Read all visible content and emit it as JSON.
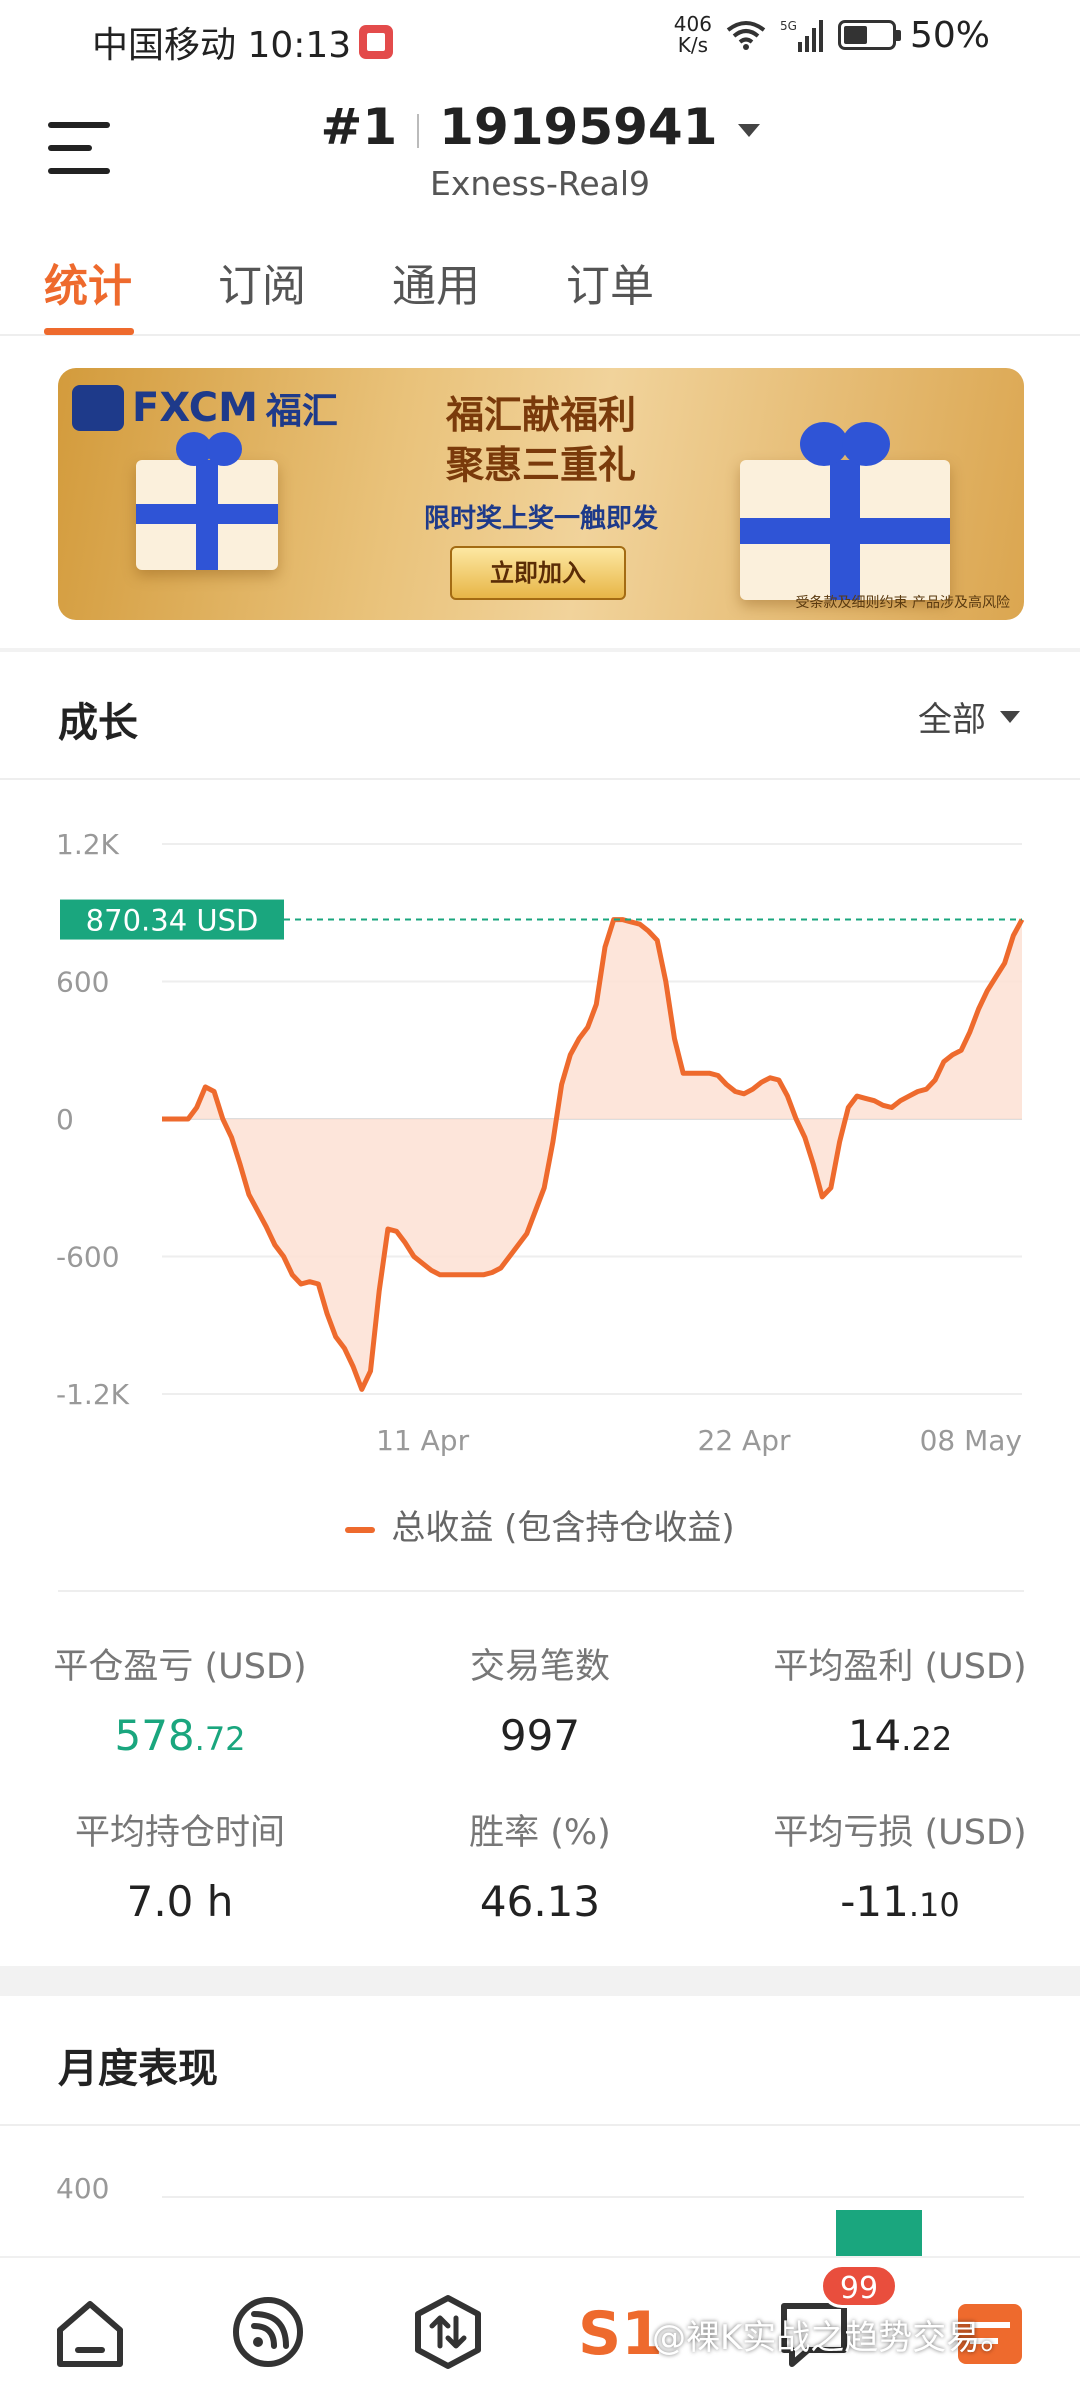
{
  "status_bar": {
    "carrier_time": "中国移动 10:13",
    "net_speed_value": "406",
    "net_speed_unit": "K/s",
    "signal": "5G",
    "battery": "50%",
    "battery_level": 0.5
  },
  "header": {
    "rank": "#1",
    "account_number": "19195941",
    "server": "Exness-Real9"
  },
  "tabs": [
    {
      "label": "统计",
      "active": true
    },
    {
      "label": "订阅",
      "active": false
    },
    {
      "label": "通用",
      "active": false
    },
    {
      "label": "订单",
      "active": false
    }
  ],
  "banner": {
    "logo_text": "FXCM",
    "logo_cn": "福汇",
    "headline_1": "福汇献福利",
    "headline_2": "聚惠三重礼",
    "subline": "限时奖上奖一触即发",
    "cta": "立即加入",
    "note": "受条款及细则约束 产品涉及高风险"
  },
  "growth": {
    "title": "成长",
    "range": "全部",
    "current_label": "870.34 USD"
  },
  "chart_data": {
    "type": "area",
    "y_ticks": [
      "1.2K",
      "600",
      "0",
      "-600",
      "-1.2K"
    ],
    "y_tick_values": [
      1200,
      600,
      0,
      -600,
      -1200
    ],
    "ylim": [
      -1200,
      1200
    ],
    "x_tick_labels": [
      "11 Apr",
      "22 Apr",
      "08 May"
    ],
    "x_tick_index": [
      30,
      67,
      99
    ],
    "reference_value": 870.34,
    "legend": "总收益 (包含持仓收益)",
    "series": [
      {
        "name": "总收益 (包含持仓收益)",
        "color": "#ee6a2d",
        "values": [
          0,
          0,
          0,
          0,
          50,
          140,
          120,
          0,
          -80,
          -200,
          -330,
          -400,
          -470,
          -550,
          -600,
          -680,
          -720,
          -710,
          -720,
          -850,
          -950,
          -1000,
          -1080,
          -1180,
          -1100,
          -750,
          -480,
          -490,
          -540,
          -600,
          -630,
          -660,
          -680,
          -680,
          -680,
          -680,
          -680,
          -680,
          -670,
          -650,
          -600,
          -550,
          -500,
          -400,
          -300,
          -100,
          150,
          280,
          350,
          400,
          500,
          750,
          870,
          870,
          860,
          850,
          820,
          780,
          600,
          350,
          200,
          200,
          200,
          200,
          190,
          150,
          120,
          110,
          130,
          160,
          180,
          170,
          100,
          0,
          -80,
          -200,
          -340,
          -300,
          -100,
          50,
          100,
          90,
          80,
          60,
          50,
          80,
          100,
          120,
          130,
          170,
          250,
          280,
          300,
          380,
          480,
          560,
          620,
          680,
          800,
          870
        ]
      }
    ]
  },
  "stats": [
    {
      "label": "平仓盈亏 (USD)",
      "int": "578",
      "dec": ".72",
      "color": "green"
    },
    {
      "label": "交易笔数",
      "int": "997",
      "dec": "",
      "color": "normal"
    },
    {
      "label": "平均盈利 (USD)",
      "int": "14",
      "dec": ".22",
      "color": "normal"
    },
    {
      "label": "平均持仓时间",
      "int": "7.0 h",
      "dec": "",
      "color": "normal"
    },
    {
      "label": "胜率 (%)",
      "int": "46.13",
      "dec": "",
      "color": "normal"
    },
    {
      "label": "平均亏损 (USD)",
      "int": "-11",
      "dec": ".10",
      "color": "normal"
    }
  ],
  "monthly": {
    "title": "月度表现",
    "y_tick_top": "400"
  },
  "bottom_nav": {
    "badge_count": "99",
    "items": [
      "home-icon",
      "feed-icon",
      "trade-icon",
      "signal-logo",
      "message-icon",
      "calendar-icon"
    ]
  },
  "watermark": "@裸K实战之趋势交易。",
  "colors": {
    "accent": "#ee6a2d",
    "green": "#1aa67e",
    "fill": "#fde0d4"
  }
}
